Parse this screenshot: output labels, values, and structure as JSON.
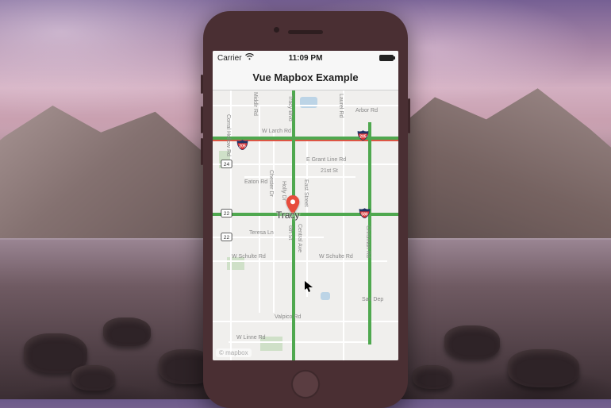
{
  "statusbar": {
    "carrier": "Carrier",
    "wifi_icon": "wifi",
    "time": "11:09 PM",
    "battery_pct": 100
  },
  "navbar": {
    "title": "Vue Mapbox Example"
  },
  "map": {
    "center_city": "Tracy",
    "attribution": "© mapbox",
    "pin": {
      "color": "#e74c3c"
    },
    "highways": {
      "interstate": [
        "205",
        "580"
      ],
      "state": [
        "24",
        "22"
      ]
    },
    "road_labels": [
      "Corral Hollow Rd",
      "W Larch Rd",
      "Tracy Blvd",
      "E Grant Line Rd",
      "21st St",
      "Eaton Rd",
      "Chester Dr",
      "Holly Dr",
      "East Street",
      "6th St",
      "Central Ave",
      "Teresa Ln",
      "W Schulte Rd",
      "W Schulte Rd",
      "Valpico Rd",
      "Chrisman Rd",
      "Laurel Rd",
      "Arbor Rd",
      "Middlr Rd",
      "San Dep",
      "W Linne Rd"
    ]
  }
}
